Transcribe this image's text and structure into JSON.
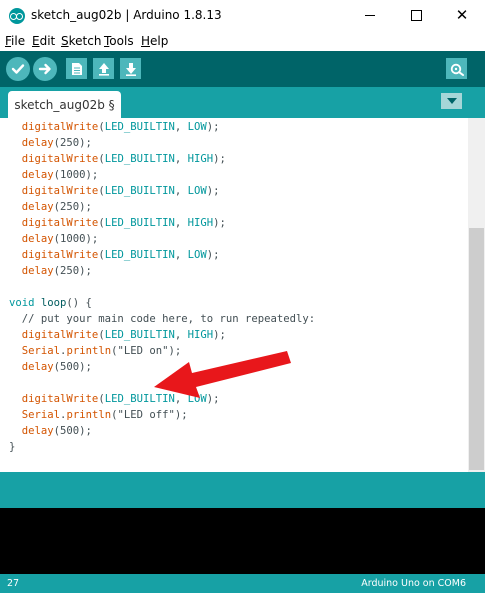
{
  "window": {
    "title": "sketch_aug02b | Arduino 1.8.13",
    "controls": [
      "minimize",
      "maximize",
      "close"
    ],
    "close_glyph": "✕"
  },
  "menu": [
    {
      "underline": "F",
      "rest": "ile"
    },
    {
      "underline": "E",
      "rest": "dit"
    },
    {
      "underline": "S",
      "rest": "ketch"
    },
    {
      "underline": "T",
      "rest": "ools"
    },
    {
      "underline": "H",
      "rest": "elp"
    }
  ],
  "toolbar": {
    "buttons": [
      "verify-icon",
      "upload-icon",
      "new-icon",
      "open-icon",
      "save-icon"
    ],
    "right_button": "serial-monitor-icon"
  },
  "tabs": [
    {
      "label": "sketch_aug02b §"
    }
  ],
  "code": [
    [
      {
        "t": "  "
      },
      {
        "t": "digitalWrite",
        "c": "orange"
      },
      {
        "t": "("
      },
      {
        "t": "LED_BUILTIN",
        "c": "teal"
      },
      {
        "t": ", "
      },
      {
        "t": "LOW",
        "c": "teal"
      },
      {
        "t": ");"
      }
    ],
    [
      {
        "t": "  "
      },
      {
        "t": "delay",
        "c": "orange"
      },
      {
        "t": "(250);"
      }
    ],
    [
      {
        "t": "  "
      },
      {
        "t": "digitalWrite",
        "c": "orange"
      },
      {
        "t": "("
      },
      {
        "t": "LED_BUILTIN",
        "c": "teal"
      },
      {
        "t": ", "
      },
      {
        "t": "HIGH",
        "c": "teal"
      },
      {
        "t": ");"
      }
    ],
    [
      {
        "t": "  "
      },
      {
        "t": "delay",
        "c": "orange"
      },
      {
        "t": "(1000);"
      }
    ],
    [
      {
        "t": "  "
      },
      {
        "t": "digitalWrite",
        "c": "orange"
      },
      {
        "t": "("
      },
      {
        "t": "LED_BUILTIN",
        "c": "teal"
      },
      {
        "t": ", "
      },
      {
        "t": "LOW",
        "c": "teal"
      },
      {
        "t": ");"
      }
    ],
    [
      {
        "t": "  "
      },
      {
        "t": "delay",
        "c": "orange"
      },
      {
        "t": "(250);"
      }
    ],
    [
      {
        "t": "  "
      },
      {
        "t": "digitalWrite",
        "c": "orange"
      },
      {
        "t": "("
      },
      {
        "t": "LED_BUILTIN",
        "c": "teal"
      },
      {
        "t": ", "
      },
      {
        "t": "HIGH",
        "c": "teal"
      },
      {
        "t": ");"
      }
    ],
    [
      {
        "t": "  "
      },
      {
        "t": "delay",
        "c": "orange"
      },
      {
        "t": "(1000);"
      }
    ],
    [
      {
        "t": "  "
      },
      {
        "t": "digitalWrite",
        "c": "orange"
      },
      {
        "t": "("
      },
      {
        "t": "LED_BUILTIN",
        "c": "teal"
      },
      {
        "t": ", "
      },
      {
        "t": "LOW",
        "c": "teal"
      },
      {
        "t": ");"
      }
    ],
    [
      {
        "t": "  "
      },
      {
        "t": "delay",
        "c": "orange"
      },
      {
        "t": "(250);"
      }
    ],
    [],
    [
      {
        "t": "void",
        "c": "teal"
      },
      {
        "t": " "
      },
      {
        "t": "loop",
        "c": "blue"
      },
      {
        "t": "() {"
      }
    ],
    [
      {
        "t": "  // put your main code here, to run repeatedly:"
      }
    ],
    [
      {
        "t": "  "
      },
      {
        "t": "digitalWrite",
        "c": "orange"
      },
      {
        "t": "("
      },
      {
        "t": "LED_BUILTIN",
        "c": "teal"
      },
      {
        "t": ", "
      },
      {
        "t": "HIGH",
        "c": "teal"
      },
      {
        "t": ");"
      }
    ],
    [
      {
        "t": "  "
      },
      {
        "t": "Serial",
        "c": "orange"
      },
      {
        "t": "."
      },
      {
        "t": "println",
        "c": "orange"
      },
      {
        "t": "(\"LED on\");"
      }
    ],
    [
      {
        "t": "  "
      },
      {
        "t": "delay",
        "c": "orange"
      },
      {
        "t": "(500);"
      }
    ],
    [],
    [
      {
        "t": "  "
      },
      {
        "t": "digitalWrite",
        "c": "orange"
      },
      {
        "t": "("
      },
      {
        "t": "LED_BUILTIN",
        "c": "teal"
      },
      {
        "t": ", "
      },
      {
        "t": "LOW",
        "c": "teal"
      },
      {
        "t": ");"
      }
    ],
    [
      {
        "t": "  "
      },
      {
        "t": "Serial",
        "c": "orange"
      },
      {
        "t": "."
      },
      {
        "t": "println",
        "c": "orange"
      },
      {
        "t": "(\"LED off\");"
      }
    ],
    [
      {
        "t": "  "
      },
      {
        "t": "delay",
        "c": "orange"
      },
      {
        "t": "(500);"
      }
    ],
    [
      {
        "t": "}"
      }
    ]
  ],
  "status": {
    "line_number": "27",
    "board": "Arduino Uno on COM6"
  },
  "colors": {
    "toolbar_bg": "#006468",
    "tabbar_bg": "#17a1a5",
    "button_bg": "#4db7bb",
    "arrow": "#e8171b",
    "keyword_orange": "#d35400",
    "keyword_teal": "#00979c"
  }
}
